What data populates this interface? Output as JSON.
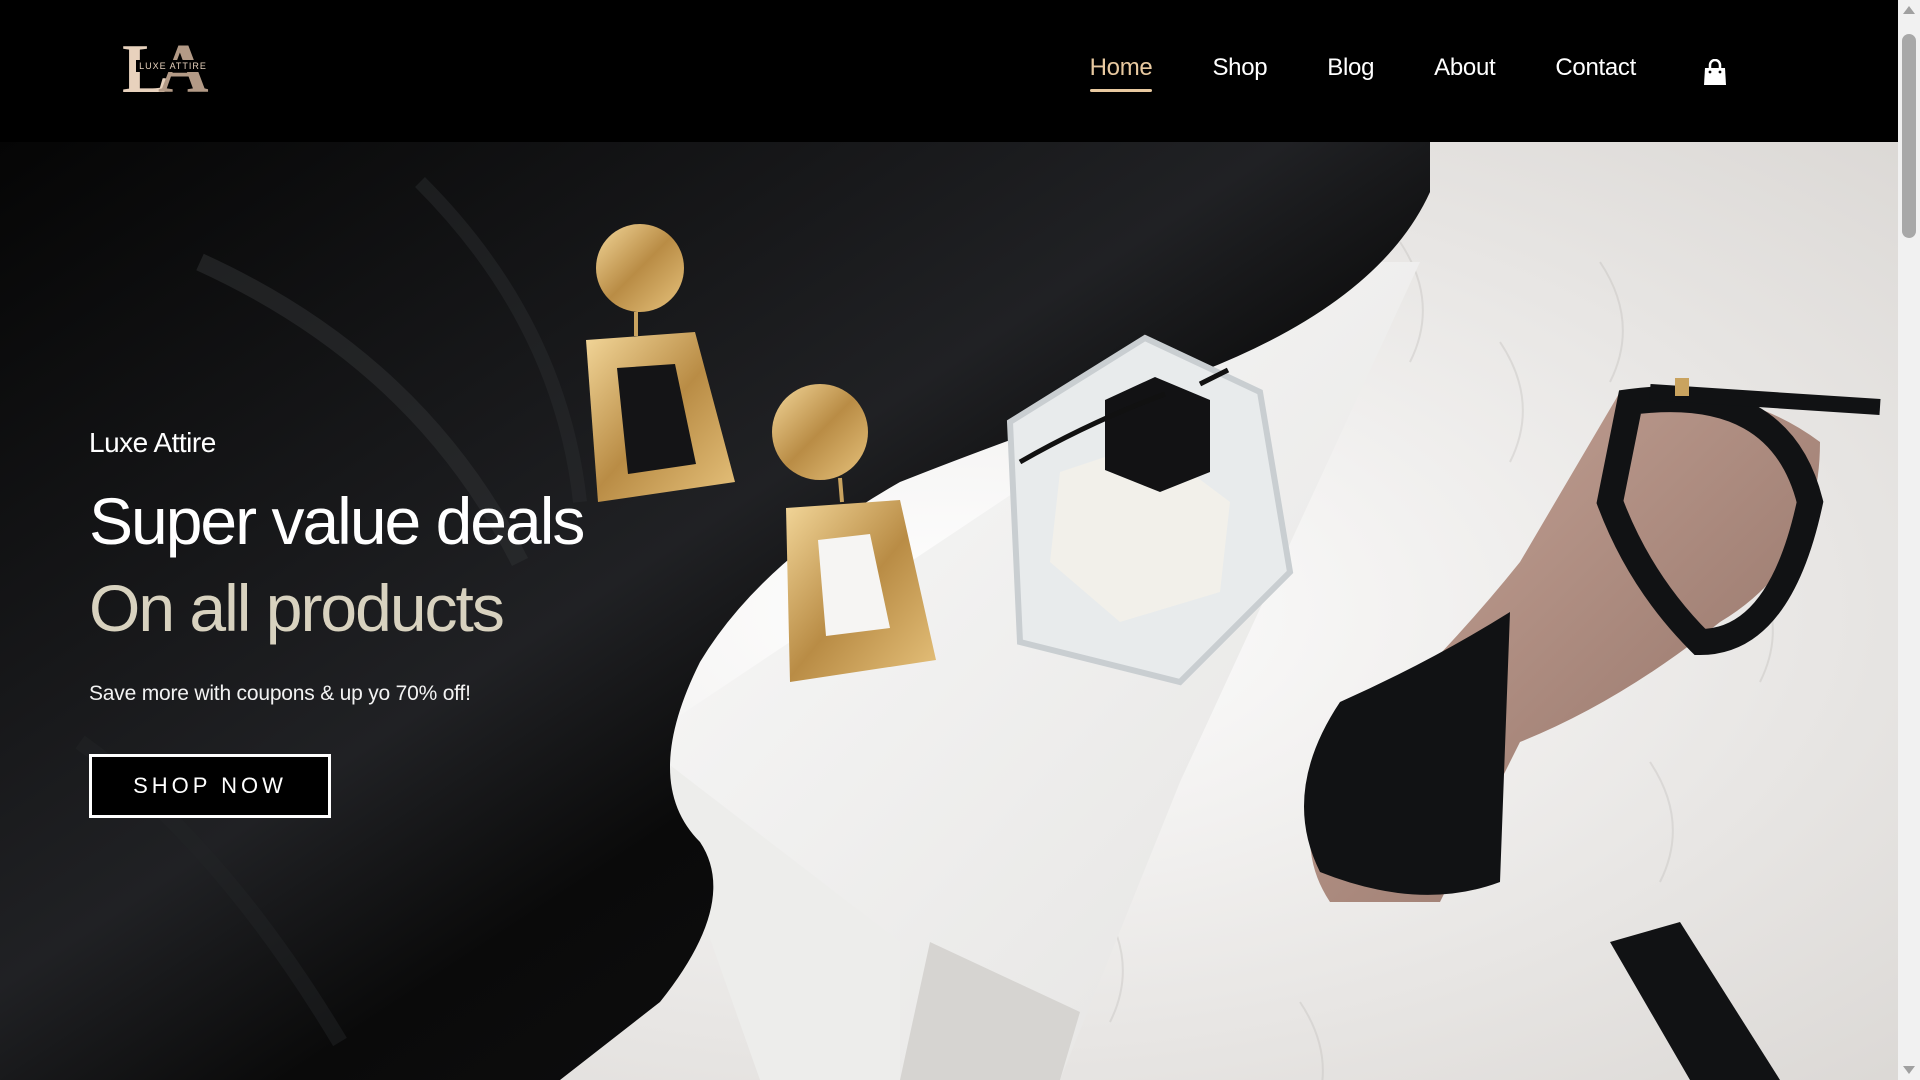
{
  "brand": {
    "logo_monogram": "LA",
    "logo_text": "LUXE ATTIRE"
  },
  "nav": {
    "items": [
      {
        "label": "Home",
        "active": true
      },
      {
        "label": "Shop",
        "active": false
      },
      {
        "label": "Blog",
        "active": false
      },
      {
        "label": "About",
        "active": false
      },
      {
        "label": "Contact",
        "active": false
      }
    ],
    "cart_icon": "shopping-bag-icon"
  },
  "hero": {
    "brand_line": "Luxe Attire",
    "headline_1": "Super value deals",
    "headline_2": "On all products",
    "subline": "Save more with coupons & up yo 70% off!",
    "cta_label": "SHOP NOW"
  },
  "colors": {
    "accent": "#e8c9a0",
    "background": "#000000",
    "headline_secondary": "#d8d2bf"
  }
}
